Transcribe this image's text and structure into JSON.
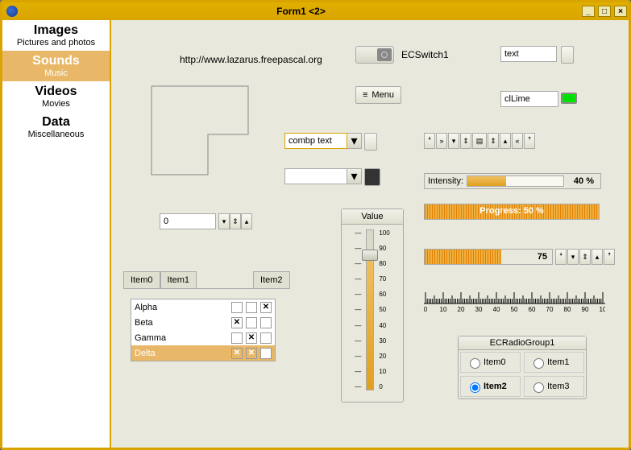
{
  "window": {
    "title": "Form1 <2>"
  },
  "sidebar": {
    "items": [
      {
        "title": "Images",
        "sub": "Pictures and photos"
      },
      {
        "title": "Sounds",
        "sub": "Music"
      },
      {
        "title": "Videos",
        "sub": "Movies"
      },
      {
        "title": "Data",
        "sub": "Miscellaneous"
      }
    ],
    "selected": 1
  },
  "link_text": "http://www.lazarus.freepascal.org",
  "switch_label": "ECSwitch1",
  "text_input": "text",
  "menu_button": "Menu",
  "color_name": "clLime",
  "combo_value": "combp text",
  "spin": {
    "value": "0"
  },
  "tabs": [
    "Item0",
    "Item1",
    "",
    "Item2"
  ],
  "list": [
    {
      "name": "Alpha",
      "c": [
        false,
        false,
        true
      ]
    },
    {
      "name": "Beta",
      "c": [
        true,
        false,
        false
      ]
    },
    {
      "name": "Gamma",
      "c": [
        false,
        true,
        false
      ]
    },
    {
      "name": "Delta",
      "c": [
        true,
        true,
        false
      ]
    }
  ],
  "list_selected": 3,
  "slider": {
    "title": "Value",
    "min": 0,
    "max": 100,
    "value": 85
  },
  "intensity": {
    "label": "Intensity:",
    "percent": 40,
    "text": "40 %"
  },
  "progress": {
    "text": "Progress: 50 %",
    "percent": 50
  },
  "posbar": {
    "value": "75",
    "percent": 60
  },
  "ruler": {
    "labels": [
      "0",
      "10",
      "20",
      "30",
      "40",
      "50",
      "60",
      "70",
      "80",
      "90",
      "10"
    ]
  },
  "radiogroup": {
    "title": "ECRadioGroup1",
    "items": [
      "Item0",
      "Item1",
      "Item2",
      "Item3"
    ],
    "selected": 2
  }
}
